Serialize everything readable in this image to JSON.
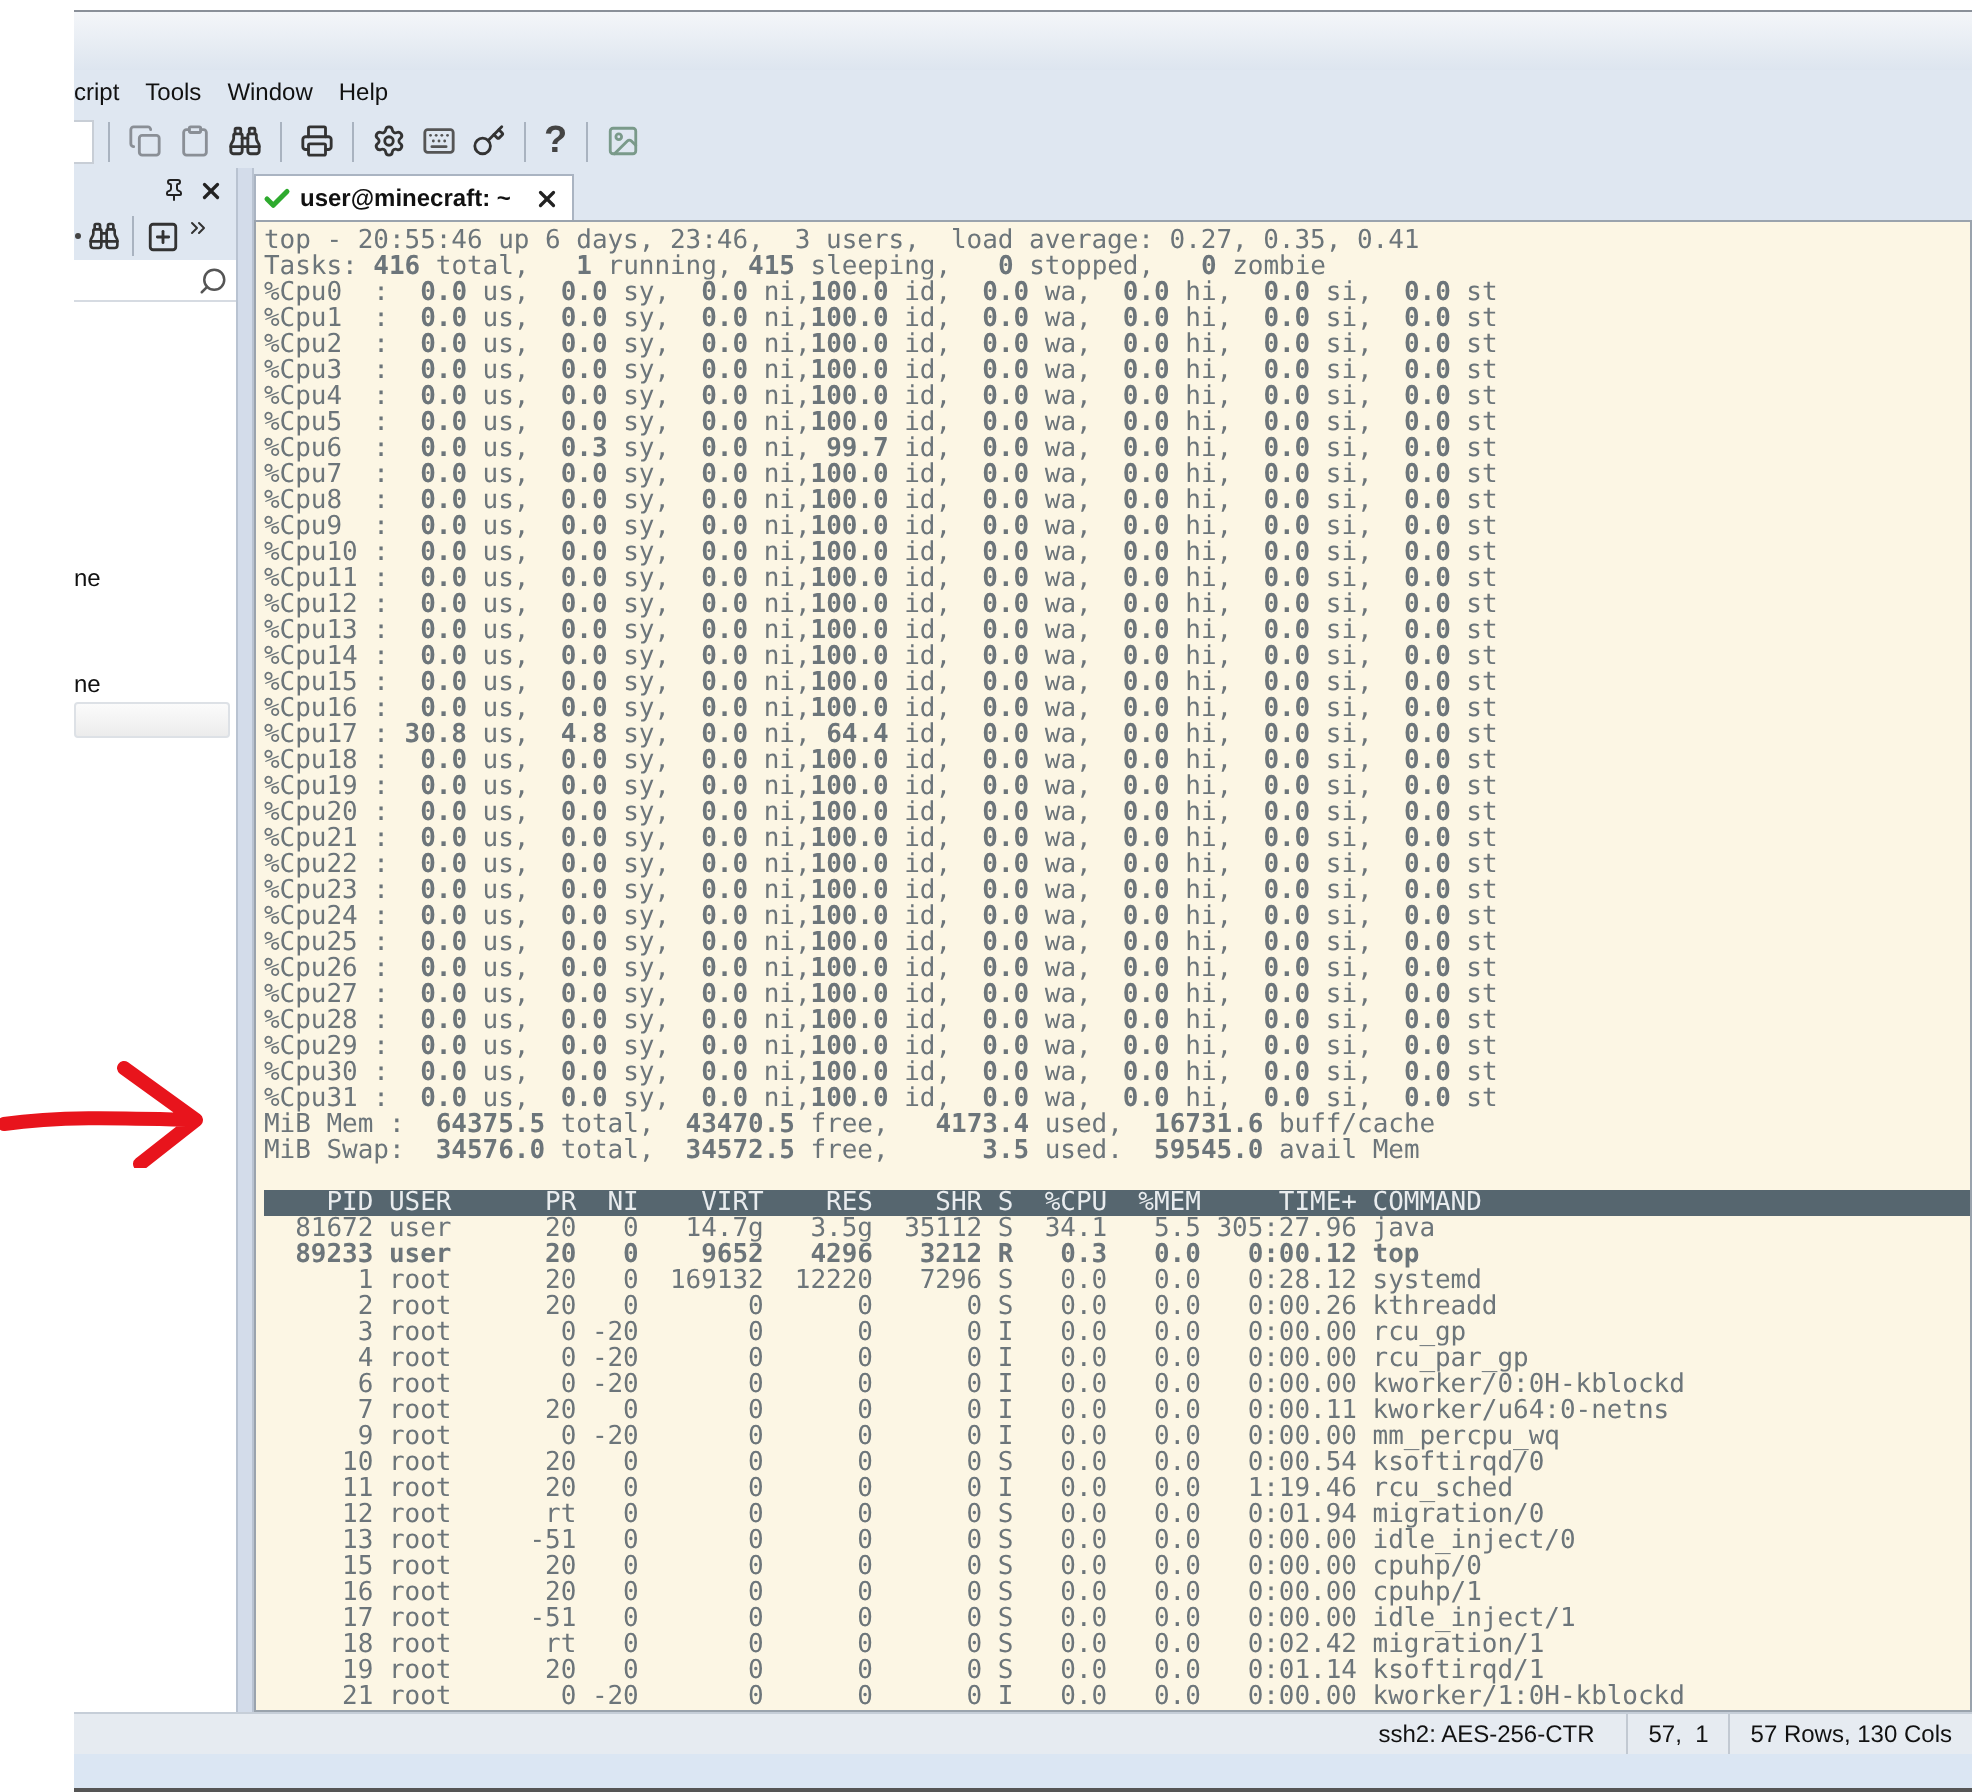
{
  "menu": [
    "cript",
    "Tools",
    "Window",
    "Help"
  ],
  "toolbar": {
    "help_glyph": "?"
  },
  "sidebar": {
    "items": [
      {
        "label": "ne",
        "selected": false
      },
      {
        "label": "ne",
        "selected": false
      }
    ]
  },
  "tabs": [
    {
      "label": "user@minecraft: ~",
      "connected": true,
      "selected": true
    }
  ],
  "terminal": {
    "summary_lines": [
      "top - 20:55:46 up 6 days, 23:46,  3 users,  load average: 0.27, 0.35, 0.41",
      "Tasks: **416** total,   **1** running, **415** sleeping,   **0** stopped,   **0** zombie",
      "%Cpu0  :  **0.0** us,  **0.0** sy,  **0.0** ni,**100.0** id,  **0.0** wa,  **0.0** hi,  **0.0** si,  **0.0** st",
      "%Cpu1  :  **0.0** us,  **0.0** sy,  **0.0** ni,**100.0** id,  **0.0** wa,  **0.0** hi,  **0.0** si,  **0.0** st",
      "%Cpu2  :  **0.0** us,  **0.0** sy,  **0.0** ni,**100.0** id,  **0.0** wa,  **0.0** hi,  **0.0** si,  **0.0** st",
      "%Cpu3  :  **0.0** us,  **0.0** sy,  **0.0** ni,**100.0** id,  **0.0** wa,  **0.0** hi,  **0.0** si,  **0.0** st",
      "%Cpu4  :  **0.0** us,  **0.0** sy,  **0.0** ni,**100.0** id,  **0.0** wa,  **0.0** hi,  **0.0** si,  **0.0** st",
      "%Cpu5  :  **0.0** us,  **0.0** sy,  **0.0** ni,**100.0** id,  **0.0** wa,  **0.0** hi,  **0.0** si,  **0.0** st",
      "%Cpu6  :  **0.0** us,  **0.3** sy,  **0.0** ni, **99.7** id,  **0.0** wa,  **0.0** hi,  **0.0** si,  **0.0** st",
      "%Cpu7  :  **0.0** us,  **0.0** sy,  **0.0** ni,**100.0** id,  **0.0** wa,  **0.0** hi,  **0.0** si,  **0.0** st",
      "%Cpu8  :  **0.0** us,  **0.0** sy,  **0.0** ni,**100.0** id,  **0.0** wa,  **0.0** hi,  **0.0** si,  **0.0** st",
      "%Cpu9  :  **0.0** us,  **0.0** sy,  **0.0** ni,**100.0** id,  **0.0** wa,  **0.0** hi,  **0.0** si,  **0.0** st",
      "%Cpu10 :  **0.0** us,  **0.0** sy,  **0.0** ni,**100.0** id,  **0.0** wa,  **0.0** hi,  **0.0** si,  **0.0** st",
      "%Cpu11 :  **0.0** us,  **0.0** sy,  **0.0** ni,**100.0** id,  **0.0** wa,  **0.0** hi,  **0.0** si,  **0.0** st",
      "%Cpu12 :  **0.0** us,  **0.0** sy,  **0.0** ni,**100.0** id,  **0.0** wa,  **0.0** hi,  **0.0** si,  **0.0** st",
      "%Cpu13 :  **0.0** us,  **0.0** sy,  **0.0** ni,**100.0** id,  **0.0** wa,  **0.0** hi,  **0.0** si,  **0.0** st",
      "%Cpu14 :  **0.0** us,  **0.0** sy,  **0.0** ni,**100.0** id,  **0.0** wa,  **0.0** hi,  **0.0** si,  **0.0** st",
      "%Cpu15 :  **0.0** us,  **0.0** sy,  **0.0** ni,**100.0** id,  **0.0** wa,  **0.0** hi,  **0.0** si,  **0.0** st",
      "%Cpu16 :  **0.0** us,  **0.0** sy,  **0.0** ni,**100.0** id,  **0.0** wa,  **0.0** hi,  **0.0** si,  **0.0** st",
      "%Cpu17 : **30.8** us,  **4.8** sy,  **0.0** ni, **64.4** id,  **0.0** wa,  **0.0** hi,  **0.0** si,  **0.0** st",
      "%Cpu18 :  **0.0** us,  **0.0** sy,  **0.0** ni,**100.0** id,  **0.0** wa,  **0.0** hi,  **0.0** si,  **0.0** st",
      "%Cpu19 :  **0.0** us,  **0.0** sy,  **0.0** ni,**100.0** id,  **0.0** wa,  **0.0** hi,  **0.0** si,  **0.0** st",
      "%Cpu20 :  **0.0** us,  **0.0** sy,  **0.0** ni,**100.0** id,  **0.0** wa,  **0.0** hi,  **0.0** si,  **0.0** st",
      "%Cpu21 :  **0.0** us,  **0.0** sy,  **0.0** ni,**100.0** id,  **0.0** wa,  **0.0** hi,  **0.0** si,  **0.0** st",
      "%Cpu22 :  **0.0** us,  **0.0** sy,  **0.0** ni,**100.0** id,  **0.0** wa,  **0.0** hi,  **0.0** si,  **0.0** st",
      "%Cpu23 :  **0.0** us,  **0.0** sy,  **0.0** ni,**100.0** id,  **0.0** wa,  **0.0** hi,  **0.0** si,  **0.0** st",
      "%Cpu24 :  **0.0** us,  **0.0** sy,  **0.0** ni,**100.0** id,  **0.0** wa,  **0.0** hi,  **0.0** si,  **0.0** st",
      "%Cpu25 :  **0.0** us,  **0.0** sy,  **0.0** ni,**100.0** id,  **0.0** wa,  **0.0** hi,  **0.0** si,  **0.0** st",
      "%Cpu26 :  **0.0** us,  **0.0** sy,  **0.0** ni,**100.0** id,  **0.0** wa,  **0.0** hi,  **0.0** si,  **0.0** st",
      "%Cpu27 :  **0.0** us,  **0.0** sy,  **0.0** ni,**100.0** id,  **0.0** wa,  **0.0** hi,  **0.0** si,  **0.0** st",
      "%Cpu28 :  **0.0** us,  **0.0** sy,  **0.0** ni,**100.0** id,  **0.0** wa,  **0.0** hi,  **0.0** si,  **0.0** st",
      "%Cpu29 :  **0.0** us,  **0.0** sy,  **0.0** ni,**100.0** id,  **0.0** wa,  **0.0** hi,  **0.0** si,  **0.0** st",
      "%Cpu30 :  **0.0** us,  **0.0** sy,  **0.0** ni,**100.0** id,  **0.0** wa,  **0.0** hi,  **0.0** si,  **0.0** st",
      "%Cpu31 :  **0.0** us,  **0.0** sy,  **0.0** ni,**100.0** id,  **0.0** wa,  **0.0** hi,  **0.0** si,  **0.0** st",
      "MiB Mem :  **64375.5** total,  **43470.5** free,   **4173.4** used,  **16731.6** buff/cache",
      "MiB Swap:  **34576.0** total,  **34572.5** free,      **3.5** used.  **59545.0** avail Mem"
    ],
    "process_header": "    PID USER      PR  NI    VIRT    RES    SHR S  %CPU  %MEM     TIME+ COMMAND",
    "processes": [
      {
        "text": "  81672 user      20   0   14.7g   3.5g  35112 S  34.1   5.5 305:27.96 java",
        "bold": false
      },
      {
        "text": "  89233 user      20   0    9652   4296   3212 R   0.3   0.0   0:00.12 top",
        "bold": true
      },
      {
        "text": "      1 root      20   0  169132  12220   7296 S   0.0   0.0   0:28.12 systemd",
        "bold": false
      },
      {
        "text": "      2 root      20   0       0      0      0 S   0.0   0.0   0:00.26 kthreadd",
        "bold": false
      },
      {
        "text": "      3 root       0 -20       0      0      0 I   0.0   0.0   0:00.00 rcu_gp",
        "bold": false
      },
      {
        "text": "      4 root       0 -20       0      0      0 I   0.0   0.0   0:00.00 rcu_par_gp",
        "bold": false
      },
      {
        "text": "      6 root       0 -20       0      0      0 I   0.0   0.0   0:00.00 kworker/0:0H-kblockd",
        "bold": false
      },
      {
        "text": "      7 root      20   0       0      0      0 I   0.0   0.0   0:00.11 kworker/u64:0-netns",
        "bold": false
      },
      {
        "text": "      9 root       0 -20       0      0      0 I   0.0   0.0   0:00.00 mm_percpu_wq",
        "bold": false
      },
      {
        "text": "     10 root      20   0       0      0      0 S   0.0   0.0   0:00.54 ksoftirqd/0",
        "bold": false
      },
      {
        "text": "     11 root      20   0       0      0      0 I   0.0   0.0   1:19.46 rcu_sched",
        "bold": false
      },
      {
        "text": "     12 root      rt   0       0      0      0 S   0.0   0.0   0:01.94 migration/0",
        "bold": false
      },
      {
        "text": "     13 root     -51   0       0      0      0 S   0.0   0.0   0:00.00 idle_inject/0",
        "bold": false
      },
      {
        "text": "     15 root      20   0       0      0      0 S   0.0   0.0   0:00.00 cpuhp/0",
        "bold": false
      },
      {
        "text": "     16 root      20   0       0      0      0 S   0.0   0.0   0:00.00 cpuhp/1",
        "bold": false
      },
      {
        "text": "     17 root     -51   0       0      0      0 S   0.0   0.0   0:00.00 idle_inject/1",
        "bold": false
      },
      {
        "text": "     18 root      rt   0       0      0      0 S   0.0   0.0   0:02.42 migration/1",
        "bold": false
      },
      {
        "text": "     19 root      20   0       0      0      0 S   0.0   0.0   0:01.14 ksoftirqd/1",
        "bold": false
      },
      {
        "text": "     21 root       0 -20       0      0      0 I   0.0   0.0   0:00.00 kworker/1:0H-kblockd",
        "bold": false
      }
    ]
  },
  "status_bar": {
    "cells": [
      "ssh2: AES-256-CTR",
      "57,  1",
      "57 Rows, 130 Cols"
    ]
  }
}
